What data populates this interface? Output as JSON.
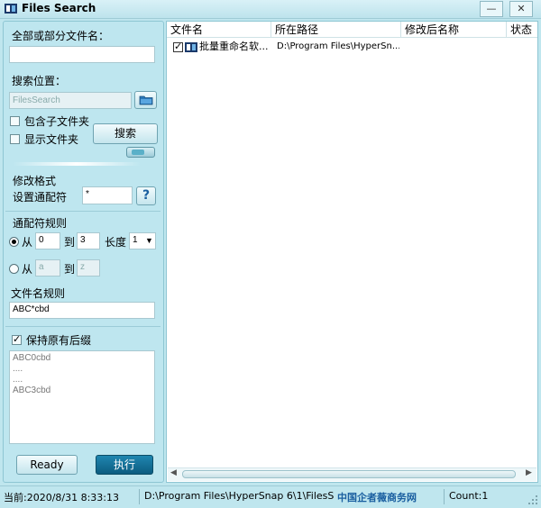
{
  "window": {
    "title": "Files Search",
    "minimize": "—",
    "close": "✕"
  },
  "search": {
    "filename_label": "全部或部分文件名：",
    "filename_value": "",
    "location_label": "搜索位置：",
    "location_value": "FilesSearch",
    "include_subfolders": {
      "label": "包含子文件夹",
      "checked": false
    },
    "show_folders": {
      "label": "显示文件夹",
      "checked": false
    },
    "search_button": "搜索"
  },
  "modify": {
    "section_label": "修改格式",
    "wildcard_label": "设置通配符",
    "wildcard_value": "*",
    "help_button": "?"
  },
  "wildcard_rules": {
    "section_label": "通配符规则",
    "numeric": {
      "from_label": "从",
      "from_value": "0",
      "to_label": "到",
      "to_value": "3",
      "length_label": "长度",
      "length_value": "1",
      "selected": true
    },
    "alpha": {
      "from_label": "从",
      "from_value": "a",
      "to_label": "到",
      "to_value": "z",
      "selected": false
    }
  },
  "filename_rule": {
    "label": "文件名规则",
    "value": "ABC*cbd"
  },
  "keep_suffix": {
    "label": "保持原有后缀",
    "checked": true
  },
  "preview": {
    "lines": [
      "ABC0cbd",
      "....",
      "....",
      "ABC3cbd"
    ]
  },
  "actions": {
    "ready": "Ready",
    "execute": "执行"
  },
  "table": {
    "columns": [
      "文件名",
      "所在路径",
      "修改后名称",
      "状态"
    ],
    "rows": [
      {
        "checked": true,
        "name": "批量重命名软...",
        "path": "D:\\Program Files\\HyperSn...",
        "new_name": "",
        "status": ""
      }
    ]
  },
  "statusbar": {
    "current": "当前:2020/8/31 8:33:13",
    "path": "D:\\Program Files\\HyperSnap 6\\1\\FilesS",
    "watermark": "中国企者薇商务网",
    "count": "Count:1"
  },
  "colors": {
    "panel_bg": "#bee6ef",
    "accent_dark": "#0c5c80",
    "border": "#8ec6d3"
  }
}
